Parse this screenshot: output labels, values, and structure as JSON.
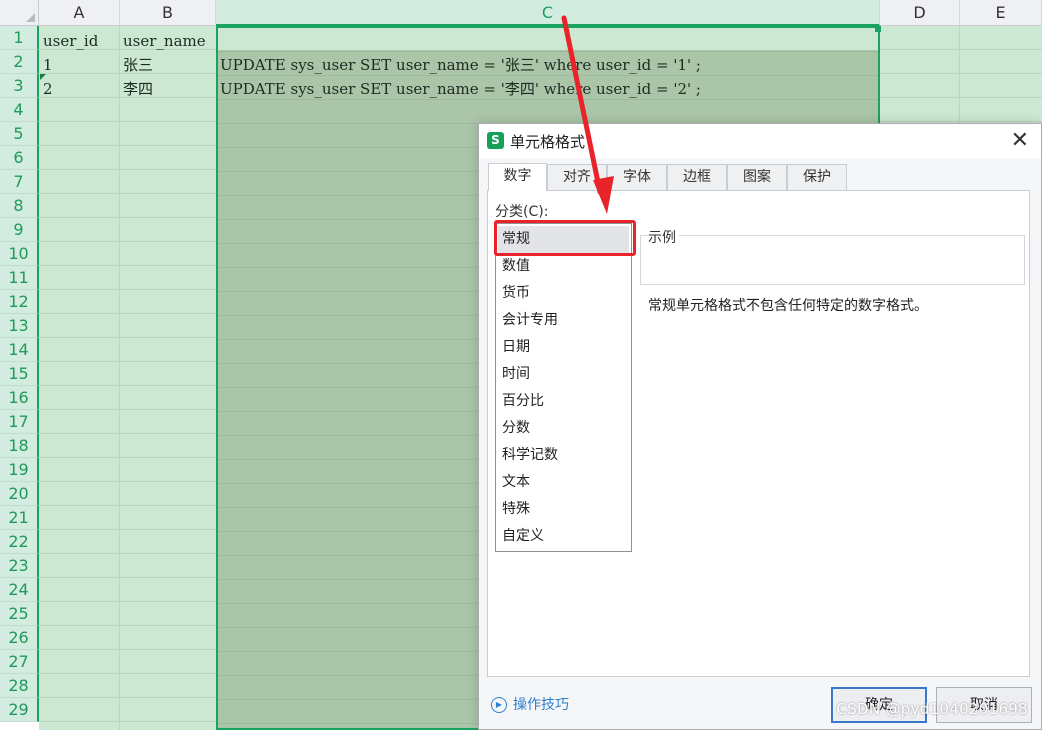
{
  "sheet": {
    "columns": [
      "A",
      "B",
      "C",
      "D",
      "E"
    ],
    "rows": [
      "1",
      "2",
      "3",
      "4",
      "5",
      "6",
      "7",
      "8",
      "9",
      "10",
      "11",
      "12",
      "13",
      "14",
      "15",
      "16",
      "17",
      "18",
      "19",
      "20",
      "21",
      "22",
      "23",
      "24",
      "25",
      "26",
      "27",
      "28",
      "29"
    ],
    "cells": {
      "a1": "user_id",
      "b1": "user_name",
      "a2": "1",
      "b2": "张三",
      "c2": "UPDATE sys_user SET user_name = '张三' where user_id = '1' ;",
      "a3": "2",
      "b3": "李四",
      "c3": "UPDATE sys_user SET user_name = '李四' where user_id = '2' ;"
    }
  },
  "dialog": {
    "title": "单元格格式",
    "app_icon": "S",
    "close_glyph": "✕",
    "tabs": [
      "数字",
      "对齐",
      "字体",
      "边框",
      "图案",
      "保护"
    ],
    "active_tab": "数字",
    "category_label": "分类(C):",
    "categories": [
      "常规",
      "数值",
      "货币",
      "会计专用",
      "日期",
      "时间",
      "百分比",
      "分数",
      "科学记数",
      "文本",
      "特殊",
      "自定义"
    ],
    "selected_category": "常规",
    "sample_label": "示例",
    "description": "常规单元格格式不包含任何特定的数字格式。",
    "tips_link": "操作技巧",
    "ok_label": "确定",
    "cancel_label": "取消"
  },
  "watermark": "CSDN @pyd1040201698",
  "colors": {
    "accent_green": "#1aa260",
    "annotation_red": "#e8242a",
    "link_blue": "#2f7fcf"
  }
}
